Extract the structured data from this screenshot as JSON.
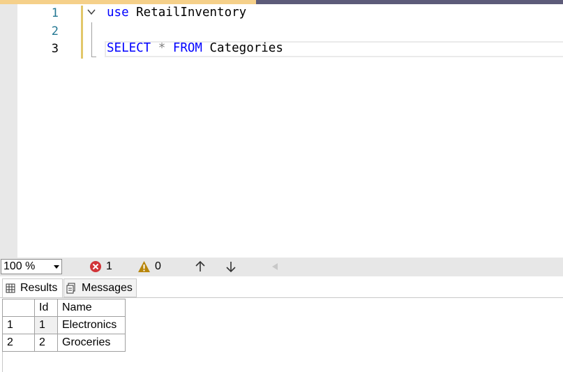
{
  "editor": {
    "line_numbers": [
      "1",
      "2",
      "3"
    ],
    "lines": [
      {
        "kw": "use",
        "rest": " RetailInventory"
      },
      {
        "kw": "",
        "rest": ""
      },
      {
        "kw1": "SELECT",
        "op": " * ",
        "kw2": "FROM",
        "rest": " Categories"
      }
    ]
  },
  "status": {
    "zoom": "100 %",
    "errors": "1",
    "warnings": "0",
    "error_icon": "error-circle-icon",
    "warning_icon": "warning-triangle-icon"
  },
  "tabs": {
    "results_label": "Results",
    "messages_label": "Messages"
  },
  "grid": {
    "columns": [
      "Id",
      "Name"
    ],
    "rows": [
      {
        "rownum": "1",
        "id": "1",
        "name": "Electronics"
      },
      {
        "rownum": "2",
        "id": "2",
        "name": "Groceries"
      }
    ]
  },
  "colors": {
    "keyword": "#0000ff",
    "line_number": "#237893",
    "change_bar": "#e2c76a",
    "error": "#d13438",
    "warning": "#b8860b"
  }
}
